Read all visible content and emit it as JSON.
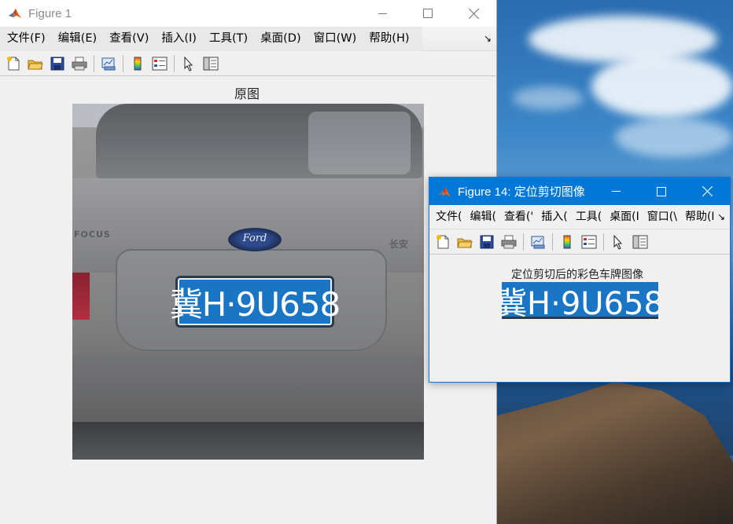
{
  "colors": {
    "titlebar_active": "#0078d7",
    "plate_blue": "#1a76c4",
    "window_bg": "#f0f0f0"
  },
  "figure1": {
    "title": "Figure 1",
    "menu": [
      "文件(F)",
      "编辑(E)",
      "查看(V)",
      "插入(I)",
      "工具(T)",
      "桌面(D)",
      "窗口(W)",
      "帮助(H)"
    ],
    "menu_more": "↘",
    "toolbar_icons": [
      "new-figure-icon",
      "open-file-icon",
      "save-icon",
      "print-icon",
      "link-plot-icon",
      "colorbar-icon",
      "legend-icon",
      "select-arrow-icon",
      "property-editor-icon"
    ],
    "axes_title": "原图",
    "photo": {
      "plate_text": "冀H·9U658",
      "logo_text": "Ford",
      "emblem_left": "FOCUS",
      "emblem_right": "长安"
    }
  },
  "figure14": {
    "title": "Figure 14: 定位剪切图像",
    "menu": [
      "文件(",
      "编辑(",
      "查看('",
      "插入(",
      "工具(",
      "桌面(I",
      "窗口(\\",
      "帮助(I"
    ],
    "menu_more": "↘",
    "toolbar_icons": [
      "new-figure-icon",
      "open-file-icon",
      "save-icon",
      "print-icon",
      "link-plot-icon",
      "colorbar-icon",
      "legend-icon",
      "select-arrow-icon",
      "property-editor-icon"
    ],
    "axes_title": "定位剪切后的彩色车牌图像",
    "plate_text": "冀H·9U658"
  }
}
